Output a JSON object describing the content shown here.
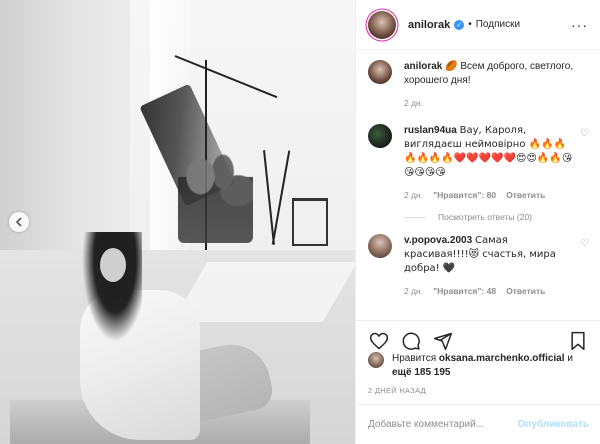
{
  "post": {
    "username": "anilorak",
    "follow_label": "Подписки",
    "more_icon": "more-horizontal-icon",
    "caption_text": "Всем доброго, светлого, хорошего дня!",
    "caption_emoji": "🏉",
    "caption_age": "2 дн."
  },
  "comments": [
    {
      "username": "ruslan94ua",
      "text": "Вау, Кароля, виглядаєш неймовірно 🔥🔥🔥🔥🔥🔥🔥❤️❤️❤️❤️❤️😍😍🔥🔥😘😘😘😘😘",
      "age": "2 дн.",
      "likes": "\"Нравится\": 80",
      "reply_label": "Ответить",
      "view_replies": "Посмотреть ответы (20)"
    },
    {
      "username": "v.popova.2003",
      "text": "Самая красивая!!!!😻 счастья, мира добра! 🖤",
      "age": "2 дн.",
      "likes": "\"Нравится\": 48",
      "reply_label": "Ответить"
    }
  ],
  "likes": {
    "prefix": "Нравится",
    "user": "oksana.marchenko.official",
    "suffix": "и",
    "more": "ещё 185 195"
  },
  "date_label": "2 ДНЕЙ НАЗАД",
  "add_comment": {
    "placeholder": "Добавьте комментарий...",
    "post_label": "Опубликовать"
  },
  "colors": {
    "accent": "#3897f0",
    "post_disabled": "#b2dffc",
    "muted": "#8e8e8e"
  }
}
